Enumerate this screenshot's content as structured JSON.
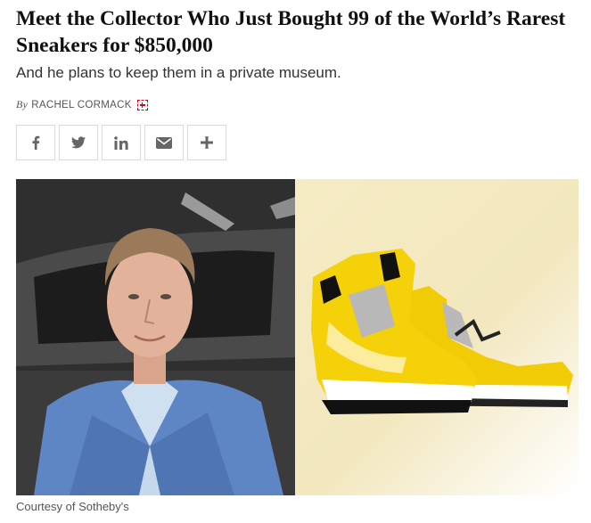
{
  "article": {
    "headline": "Meet the Collector Who Just Bought 99 of the World’s Rarest Sneakers for $850,000",
    "dek": "And he plans to keep them in a private museum.",
    "byline_prefix": "By",
    "author": "RACHEL CORMACK",
    "photo_credit": "Courtesy of Sotheby's"
  },
  "share": {
    "buttons": [
      {
        "icon": "facebook-icon"
      },
      {
        "icon": "twitter-icon"
      },
      {
        "icon": "linkedin-icon"
      },
      {
        "icon": "email-icon"
      },
      {
        "icon": "plus-icon"
      }
    ]
  },
  "colors": {
    "follow_accent": "#d0021b",
    "share_icon": "#666666",
    "sneaker_yellow": "#f2cb07"
  }
}
